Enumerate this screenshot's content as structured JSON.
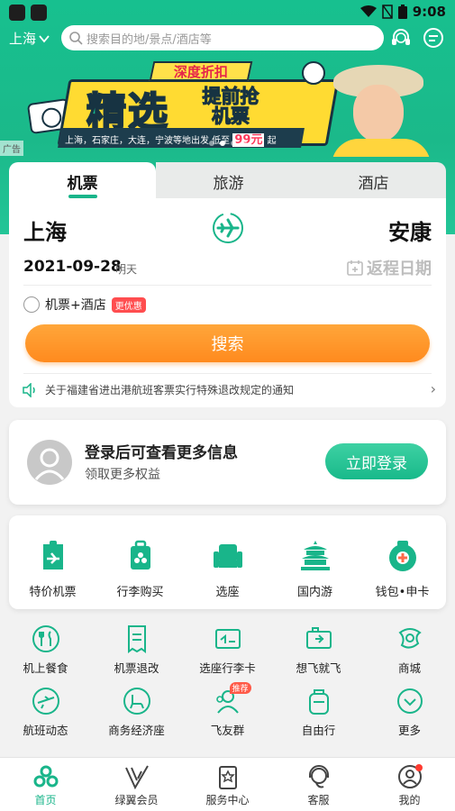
{
  "colors": {
    "brand_green": "#19b58a",
    "search_orange": "#ff8a1e",
    "badge_red": "#ff4d4f"
  },
  "status_bar": {
    "time": "9:08"
  },
  "header": {
    "city": "上海",
    "search_placeholder": "搜索目的地/景点/酒店等",
    "icons": [
      "headset-icon",
      "message-icon"
    ]
  },
  "banner": {
    "tag": "深度折扣",
    "headline_big": "精选",
    "headline_small_top": "提前抢",
    "headline_small_bottom": "机票",
    "strip_text": "上海，石家庄，大连，宁波等地出发  低至",
    "price": "99元",
    "price_suffix": "起",
    "ad_label": "广告"
  },
  "tabs": [
    {
      "label": "机票",
      "active": true
    },
    {
      "label": "旅游",
      "active": false
    },
    {
      "label": "酒店",
      "active": false
    }
  ],
  "booking": {
    "from_city": "上海",
    "to_city": "安康",
    "date": "2021-09-28",
    "date_day": "明天",
    "return_label": "返程日期",
    "combo_label": "机票+酒店",
    "combo_badge": "更优惠",
    "search_label": "搜索",
    "notice": "关于福建省进出港航班客票实行特殊退改规定的通知"
  },
  "login": {
    "title": "登录后可查看更多信息",
    "subtitle": "领取更多权益",
    "button": "立即登录"
  },
  "primary_services": [
    {
      "label": "特价机票",
      "icon": "boarding-pass-icon"
    },
    {
      "label": "行李购买",
      "icon": "luggage-icon"
    },
    {
      "label": "选座",
      "icon": "seat-icon"
    },
    {
      "label": "国内游",
      "icon": "temple-icon"
    },
    {
      "label": "钱包•申卡",
      "icon": "wallet-icon"
    }
  ],
  "secondary_services": [
    {
      "label": "机上餐食",
      "icon": "meal-icon"
    },
    {
      "label": "机票退改",
      "icon": "refund-icon"
    },
    {
      "label": "选座行李卡",
      "icon": "seat-card-icon"
    },
    {
      "label": "想飞就飞",
      "icon": "fly-ticket-icon"
    },
    {
      "label": "商城",
      "icon": "mall-icon"
    },
    {
      "label": "航班动态",
      "icon": "flight-status-icon"
    },
    {
      "label": "商务经济座",
      "icon": "business-seat-icon"
    },
    {
      "label": "飞友群",
      "icon": "group-icon",
      "badge": "推荐"
    },
    {
      "label": "自由行",
      "icon": "backpack-icon"
    },
    {
      "label": "更多",
      "icon": "more-icon"
    }
  ],
  "bottom_nav": [
    {
      "label": "首页",
      "icon": "home-icon",
      "active": true
    },
    {
      "label": "绿翼会员",
      "icon": "member-icon",
      "active": false
    },
    {
      "label": "服务中心",
      "icon": "service-center-icon",
      "active": false
    },
    {
      "label": "客服",
      "icon": "customer-service-icon",
      "active": false
    },
    {
      "label": "我的",
      "icon": "profile-icon",
      "active": false,
      "has_dot": true
    }
  ]
}
